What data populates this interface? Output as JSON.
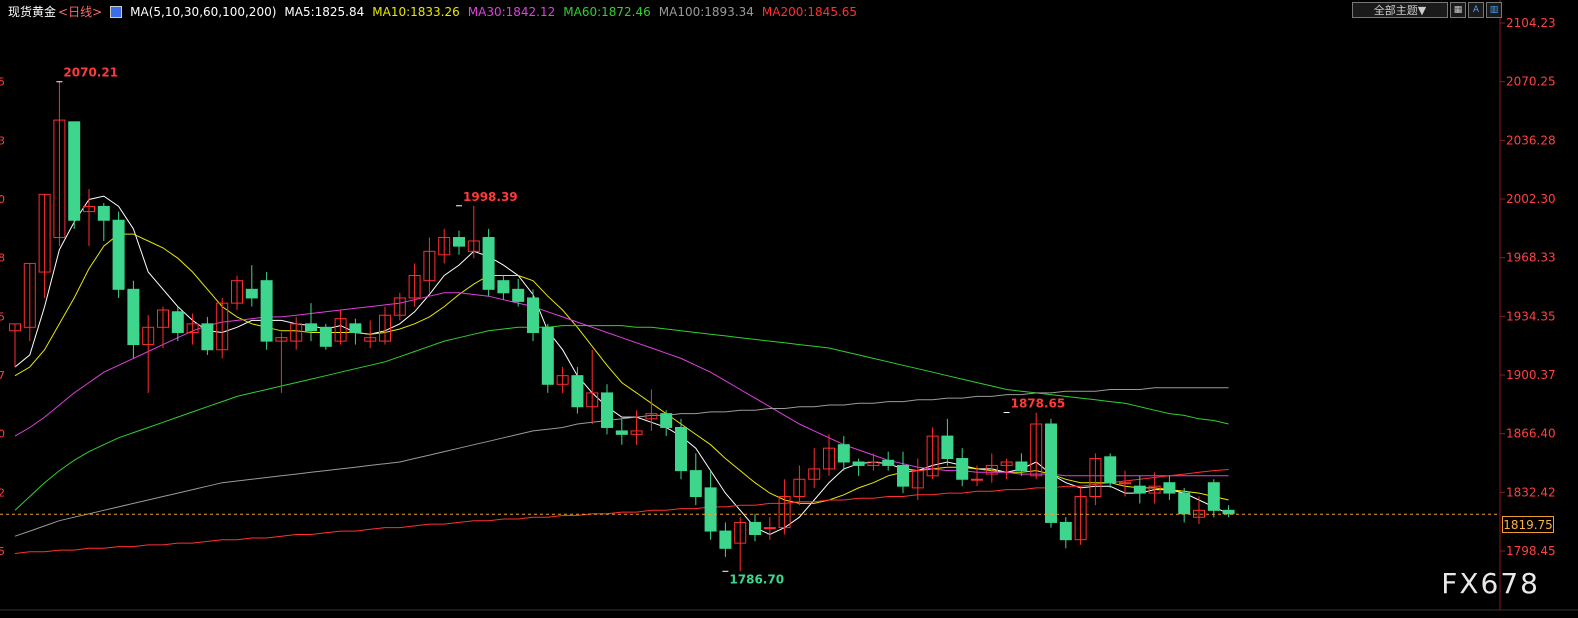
{
  "header": {
    "instrument": "现货黄金",
    "period": "<日线>",
    "ma_params": "MA(5,10,30,60,100,200)",
    "ma_values": [
      {
        "label": "MA5:1825.84",
        "color": "#ffffff"
      },
      {
        "label": "MA10:1833.26",
        "color": "#e8e800"
      },
      {
        "label": "MA30:1842.12",
        "color": "#e040e0"
      },
      {
        "label": "MA60:1872.46",
        "color": "#30d030"
      },
      {
        "label": "MA100:1893.34",
        "color": "#9a9a9a"
      },
      {
        "label": "MA200:1845.65",
        "color": "#ff3030"
      }
    ]
  },
  "toolbar": {
    "theme_label": "全部主题▼",
    "icons": [
      "table-icon",
      "font-icon",
      "chart-icon"
    ]
  },
  "watermark": "FX678",
  "colors": {
    "up": "#ff2d2d",
    "down": "#3dd68c",
    "background": "#000000",
    "axis_text": "#ff4040",
    "grid": "#1c1c1c"
  },
  "chart_data": {
    "type": "candlestick",
    "ylim": [
      1780,
      2110
    ],
    "yticks": [
      {
        "value": 2104.23,
        "label": "2104.23"
      },
      {
        "value": 2070.25,
        "label": "2070.25"
      },
      {
        "value": 2036.28,
        "label": "2036.28"
      },
      {
        "value": 2002.3,
        "label": "2002.30"
      },
      {
        "value": 1968.33,
        "label": "1968.33"
      },
      {
        "value": 1934.35,
        "label": "1934.35"
      },
      {
        "value": 1900.37,
        "label": "1900.37"
      },
      {
        "value": 1866.4,
        "label": "1866.40"
      },
      {
        "value": 1832.42,
        "label": "1832.42"
      },
      {
        "value": 1798.45,
        "label": "1798.45"
      }
    ],
    "left_partial_ticks": [
      "5",
      "3",
      "0",
      "8",
      "5",
      "7",
      "0",
      "2",
      "5"
    ],
    "last_price": {
      "value": 1819.75,
      "label": "1819.75"
    },
    "annotations": [
      {
        "index": 3,
        "value": 2070.21,
        "label": "2070.21",
        "kind": "high"
      },
      {
        "index": 30,
        "value": 1998.39,
        "label": "1998.39",
        "kind": "high"
      },
      {
        "index": 48,
        "value": 1786.7,
        "label": "1786.70",
        "kind": "low"
      },
      {
        "index": 67,
        "value": 1878.65,
        "label": "1878.65",
        "kind": "high"
      }
    ],
    "candles": [
      [
        1926,
        1930,
        1915,
        1905
      ],
      [
        1928,
        1965,
        1925,
        1920
      ],
      [
        1960,
        2005,
        1958,
        1945
      ],
      [
        1980,
        2048,
        1975,
        2070.21
      ],
      [
        2047,
        1990,
        2045,
        1985
      ],
      [
        1995,
        1998,
        2008,
        1975
      ],
      [
        1998,
        1990,
        2000,
        1978
      ],
      [
        1990,
        1950,
        1995,
        1945
      ],
      [
        1950,
        1918,
        1955,
        1910
      ],
      [
        1918,
        1928,
        1935,
        1890
      ],
      [
        1928,
        1938,
        1940,
        1916
      ],
      [
        1937,
        1925,
        1940,
        1920
      ],
      [
        1925,
        1930,
        1936,
        1918
      ],
      [
        1930,
        1915,
        1934,
        1912
      ],
      [
        1915,
        1942,
        1945,
        1910
      ],
      [
        1942,
        1955,
        1958,
        1938
      ],
      [
        1950,
        1945,
        1964,
        1940
      ],
      [
        1955,
        1920,
        1960,
        1915
      ],
      [
        1920,
        1922,
        1925,
        1890
      ],
      [
        1920,
        1930,
        1934,
        1915
      ],
      [
        1930,
        1926,
        1942,
        1920
      ],
      [
        1928,
        1917,
        1930,
        1915
      ],
      [
        1920,
        1933,
        1938,
        1918
      ],
      [
        1930,
        1925,
        1933,
        1918
      ],
      [
        1920,
        1922,
        1932,
        1916
      ],
      [
        1920,
        1935,
        1940,
        1918
      ],
      [
        1935,
        1945,
        1948,
        1932
      ],
      [
        1945,
        1958,
        1965,
        1940
      ],
      [
        1955,
        1972,
        1980,
        1948
      ],
      [
        1970,
        1980,
        1985,
        1965
      ],
      [
        1980,
        1975,
        1984,
        1970
      ],
      [
        1972,
        1978,
        1998.39,
        1968
      ],
      [
        1980,
        1950,
        1985,
        1946
      ],
      [
        1955,
        1948,
        1958,
        1944
      ],
      [
        1950,
        1943,
        1956,
        1940
      ],
      [
        1945,
        1925,
        1950,
        1920
      ],
      [
        1928,
        1895,
        1930,
        1890
      ],
      [
        1895,
        1900,
        1905,
        1890
      ],
      [
        1900,
        1882,
        1905,
        1878
      ],
      [
        1882,
        1890,
        1915,
        1872
      ],
      [
        1890,
        1870,
        1895,
        1866
      ],
      [
        1868,
        1866,
        1875,
        1860
      ],
      [
        1866,
        1868,
        1880,
        1860
      ],
      [
        1875,
        1878,
        1892,
        1868
      ],
      [
        1878,
        1870,
        1880,
        1865
      ],
      [
        1870,
        1845,
        1875,
        1840
      ],
      [
        1845,
        1830,
        1855,
        1825
      ],
      [
        1835,
        1810,
        1845,
        1805
      ],
      [
        1810,
        1800,
        1815,
        1795
      ],
      [
        1803,
        1815,
        1818,
        1786.7
      ],
      [
        1815,
        1808,
        1820,
        1804
      ],
      [
        1812,
        1812,
        1818,
        1805
      ],
      [
        1812,
        1830,
        1840,
        1808
      ],
      [
        1830,
        1840,
        1848,
        1825
      ],
      [
        1840,
        1846,
        1858,
        1835
      ],
      [
        1846,
        1858,
        1866,
        1842
      ],
      [
        1860,
        1850,
        1865,
        1845
      ],
      [
        1850,
        1848,
        1852,
        1842
      ],
      [
        1848,
        1850,
        1855,
        1845
      ],
      [
        1851,
        1848,
        1856,
        1845
      ],
      [
        1848,
        1836,
        1856,
        1832
      ],
      [
        1835,
        1845,
        1852,
        1828
      ],
      [
        1842,
        1865,
        1870,
        1840
      ],
      [
        1865,
        1852,
        1875,
        1848
      ],
      [
        1852,
        1840,
        1858,
        1836
      ],
      [
        1840,
        1840,
        1848,
        1836
      ],
      [
        1843,
        1848,
        1855,
        1838
      ],
      [
        1848,
        1850,
        1852,
        1840
      ],
      [
        1850,
        1845,
        1855,
        1842
      ],
      [
        1842,
        1872,
        1878.65,
        1840
      ],
      [
        1872,
        1815,
        1875,
        1812
      ],
      [
        1815,
        1805,
        1818,
        1800
      ],
      [
        1805,
        1830,
        1835,
        1802
      ],
      [
        1830,
        1852,
        1855,
        1825
      ],
      [
        1853,
        1838,
        1855,
        1835
      ],
      [
        1838,
        1838,
        1845,
        1830
      ],
      [
        1836,
        1832,
        1842,
        1826
      ],
      [
        1832,
        1836,
        1844,
        1826
      ],
      [
        1838,
        1832,
        1842,
        1828
      ],
      [
        1832,
        1820,
        1835,
        1815
      ],
      [
        1818,
        1822,
        1830,
        1814
      ],
      [
        1838,
        1822,
        1840,
        1818
      ],
      [
        1822,
        1820,
        1825,
        1818
      ]
    ],
    "series": [
      {
        "name": "MA5",
        "color": "#ffffff",
        "values": [
          1905,
          1912,
          1940,
          1973,
          1989,
          2002,
          2004,
          1998,
          1985,
          1960,
          1950,
          1940,
          1932,
          1926,
          1925,
          1928,
          1932,
          1932,
          1932,
          1930,
          1929,
          1927,
          1929,
          1925,
          1924,
          1926,
          1930,
          1937,
          1947,
          1958,
          1964,
          1972,
          1969,
          1964,
          1958,
          1947,
          1926,
          1915,
          1900,
          1890,
          1882,
          1876,
          1876,
          1873,
          1870,
          1865,
          1858,
          1845,
          1832,
          1822,
          1812,
          1808,
          1812,
          1818,
          1828,
          1838,
          1846,
          1849,
          1850,
          1849,
          1846,
          1845,
          1848,
          1850,
          1848,
          1846,
          1846,
          1844,
          1846,
          1850,
          1843,
          1838,
          1835,
          1836,
          1836,
          1832,
          1832,
          1834,
          1834,
          1832,
          1828,
          1824,
          1820
        ]
      },
      {
        "name": "MA10",
        "color": "#e8e800",
        "values": [
          1900,
          1905,
          1915,
          1930,
          1945,
          1962,
          1975,
          1982,
          1982,
          1978,
          1974,
          1968,
          1960,
          1950,
          1940,
          1934,
          1930,
          1928,
          1926,
          1926,
          1925,
          1925,
          1925,
          1925,
          1924,
          1925,
          1927,
          1930,
          1934,
          1940,
          1947,
          1953,
          1958,
          1958,
          1958,
          1955,
          1946,
          1938,
          1928,
          1917,
          1906,
          1896,
          1890,
          1884,
          1878,
          1872,
          1866,
          1860,
          1852,
          1845,
          1838,
          1832,
          1828,
          1826,
          1826,
          1828,
          1831,
          1835,
          1838,
          1842,
          1844,
          1845,
          1846,
          1847,
          1847,
          1846,
          1845,
          1844,
          1844,
          1845,
          1843,
          1840,
          1838,
          1838,
          1838,
          1836,
          1835,
          1835,
          1834,
          1833,
          1832,
          1830,
          1828
        ]
      },
      {
        "name": "MA30",
        "color": "#e040e0",
        "values": [
          1865,
          1870,
          1876,
          1883,
          1890,
          1896,
          1902,
          1906,
          1910,
          1914,
          1918,
          1922,
          1926,
          1929,
          1931,
          1932,
          1933,
          1934,
          1934,
          1935,
          1936,
          1937,
          1938,
          1939,
          1940,
          1941,
          1942,
          1944,
          1946,
          1948,
          1948,
          1947,
          1946,
          1944,
          1942,
          1940,
          1937,
          1934,
          1931,
          1928,
          1925,
          1922,
          1919,
          1916,
          1913,
          1910,
          1906,
          1902,
          1897,
          1892,
          1887,
          1882,
          1877,
          1872,
          1868,
          1864,
          1860,
          1857,
          1854,
          1851,
          1849,
          1847,
          1846,
          1845,
          1845,
          1844,
          1844,
          1844,
          1843,
          1843,
          1843,
          1842,
          1842,
          1842,
          1842,
          1842,
          1842,
          1842,
          1842,
          1842,
          1842,
          1842,
          1842
        ]
      },
      {
        "name": "MA60",
        "color": "#30d030",
        "values": [
          1822,
          1830,
          1838,
          1845,
          1851,
          1856,
          1860,
          1864,
          1867,
          1870,
          1873,
          1876,
          1879,
          1882,
          1885,
          1888,
          1890,
          1892,
          1894,
          1896,
          1898,
          1900,
          1902,
          1904,
          1906,
          1908,
          1911,
          1914,
          1917,
          1920,
          1922,
          1924,
          1926,
          1927,
          1928,
          1928,
          1928,
          1929,
          1929,
          1929,
          1929,
          1929,
          1928,
          1928,
          1927,
          1926,
          1925,
          1924,
          1923,
          1922,
          1921,
          1920,
          1919,
          1918,
          1917,
          1916,
          1914,
          1912,
          1910,
          1908,
          1906,
          1904,
          1902,
          1900,
          1898,
          1896,
          1894,
          1892,
          1891,
          1890,
          1889,
          1888,
          1887,
          1886,
          1885,
          1884,
          1882,
          1880,
          1878,
          1877,
          1875,
          1874,
          1872
        ]
      },
      {
        "name": "MA100",
        "color": "#9a9a9a",
        "values": [
          1807,
          1810,
          1813,
          1816,
          1818,
          1820,
          1822,
          1824,
          1826,
          1828,
          1830,
          1832,
          1834,
          1836,
          1838,
          1839,
          1840,
          1841,
          1842,
          1843,
          1844,
          1845,
          1846,
          1847,
          1848,
          1849,
          1850,
          1852,
          1854,
          1856,
          1858,
          1860,
          1862,
          1864,
          1866,
          1868,
          1869,
          1870,
          1872,
          1873,
          1874,
          1875,
          1876,
          1877,
          1877,
          1878,
          1878,
          1879,
          1879,
          1880,
          1880,
          1881,
          1881,
          1882,
          1882,
          1883,
          1883,
          1884,
          1884,
          1885,
          1885,
          1886,
          1886,
          1887,
          1887,
          1888,
          1888,
          1889,
          1889,
          1890,
          1890,
          1891,
          1891,
          1891,
          1892,
          1892,
          1892,
          1893,
          1893,
          1893,
          1893,
          1893,
          1893
        ]
      },
      {
        "name": "MA200",
        "color": "#ff3030",
        "values": [
          1797,
          1798,
          1798,
          1799,
          1799,
          1800,
          1800,
          1801,
          1801,
          1802,
          1802,
          1803,
          1803,
          1804,
          1805,
          1805,
          1806,
          1806,
          1807,
          1808,
          1808,
          1809,
          1810,
          1810,
          1811,
          1812,
          1812,
          1813,
          1814,
          1814,
          1815,
          1816,
          1816,
          1817,
          1817,
          1818,
          1818,
          1819,
          1819,
          1820,
          1820,
          1821,
          1821,
          1822,
          1822,
          1823,
          1823,
          1824,
          1824,
          1825,
          1825,
          1826,
          1826,
          1827,
          1827,
          1828,
          1828,
          1829,
          1829,
          1830,
          1830,
          1831,
          1831,
          1832,
          1832,
          1833,
          1833,
          1834,
          1834,
          1835,
          1835,
          1836,
          1836,
          1837,
          1838,
          1839,
          1840,
          1841,
          1842,
          1843,
          1844,
          1845,
          1845.65
        ]
      }
    ]
  }
}
